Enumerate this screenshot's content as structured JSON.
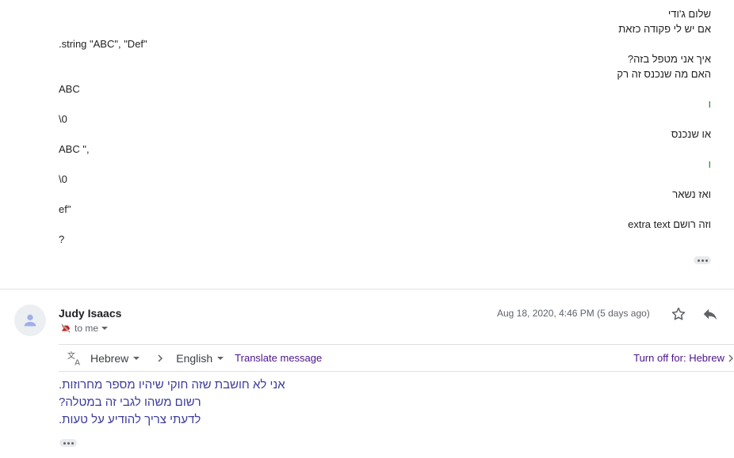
{
  "previous_message": {
    "lines": {
      "greeting": "שלום ג'ודי",
      "question1": "אם יש לי פקודה כזאת",
      "command": ".string \"ABC\", \"Def\"",
      "question2": "איך אני מטפל בזה?",
      "question3": "האם מה שנכנס זה רק",
      "abc": "ABC",
      "null1": "\\0",
      "vav1": "ו",
      "or_entered": "או שנכנס",
      "abc_quote": "ABC \",",
      "vav2": "ו",
      "null2": "\\0",
      "remaining": "ואז נשאר",
      "ef": "ef\"",
      "extra": "וזה רושם extra text",
      "question_mark": "?"
    }
  },
  "message": {
    "sender": "Judy Isaacs",
    "recipient": "to me",
    "date": "Aug 18, 2020, 4:46 PM (5 days ago)",
    "translate": {
      "from_lang": "Hebrew",
      "to_lang": "English",
      "translate_link": "Translate message",
      "turn_off": "Turn off for: Hebrew"
    },
    "body": [
      "אני לא חושבת שזה חוקי שיהיו מספר מחרוזות.",
      "רשום משהו לגבי זה במטלה?",
      "לדעתי צריך להודיע על טעות."
    ]
  },
  "colors": {
    "translated_text": "#3c3c9a",
    "link": "#4a148c",
    "green_tick": "#188038"
  },
  "icons": [
    "avatar-icon",
    "label-important-icon",
    "star-icon",
    "reply-icon",
    "translate-icon",
    "chevron-right-icon"
  ]
}
